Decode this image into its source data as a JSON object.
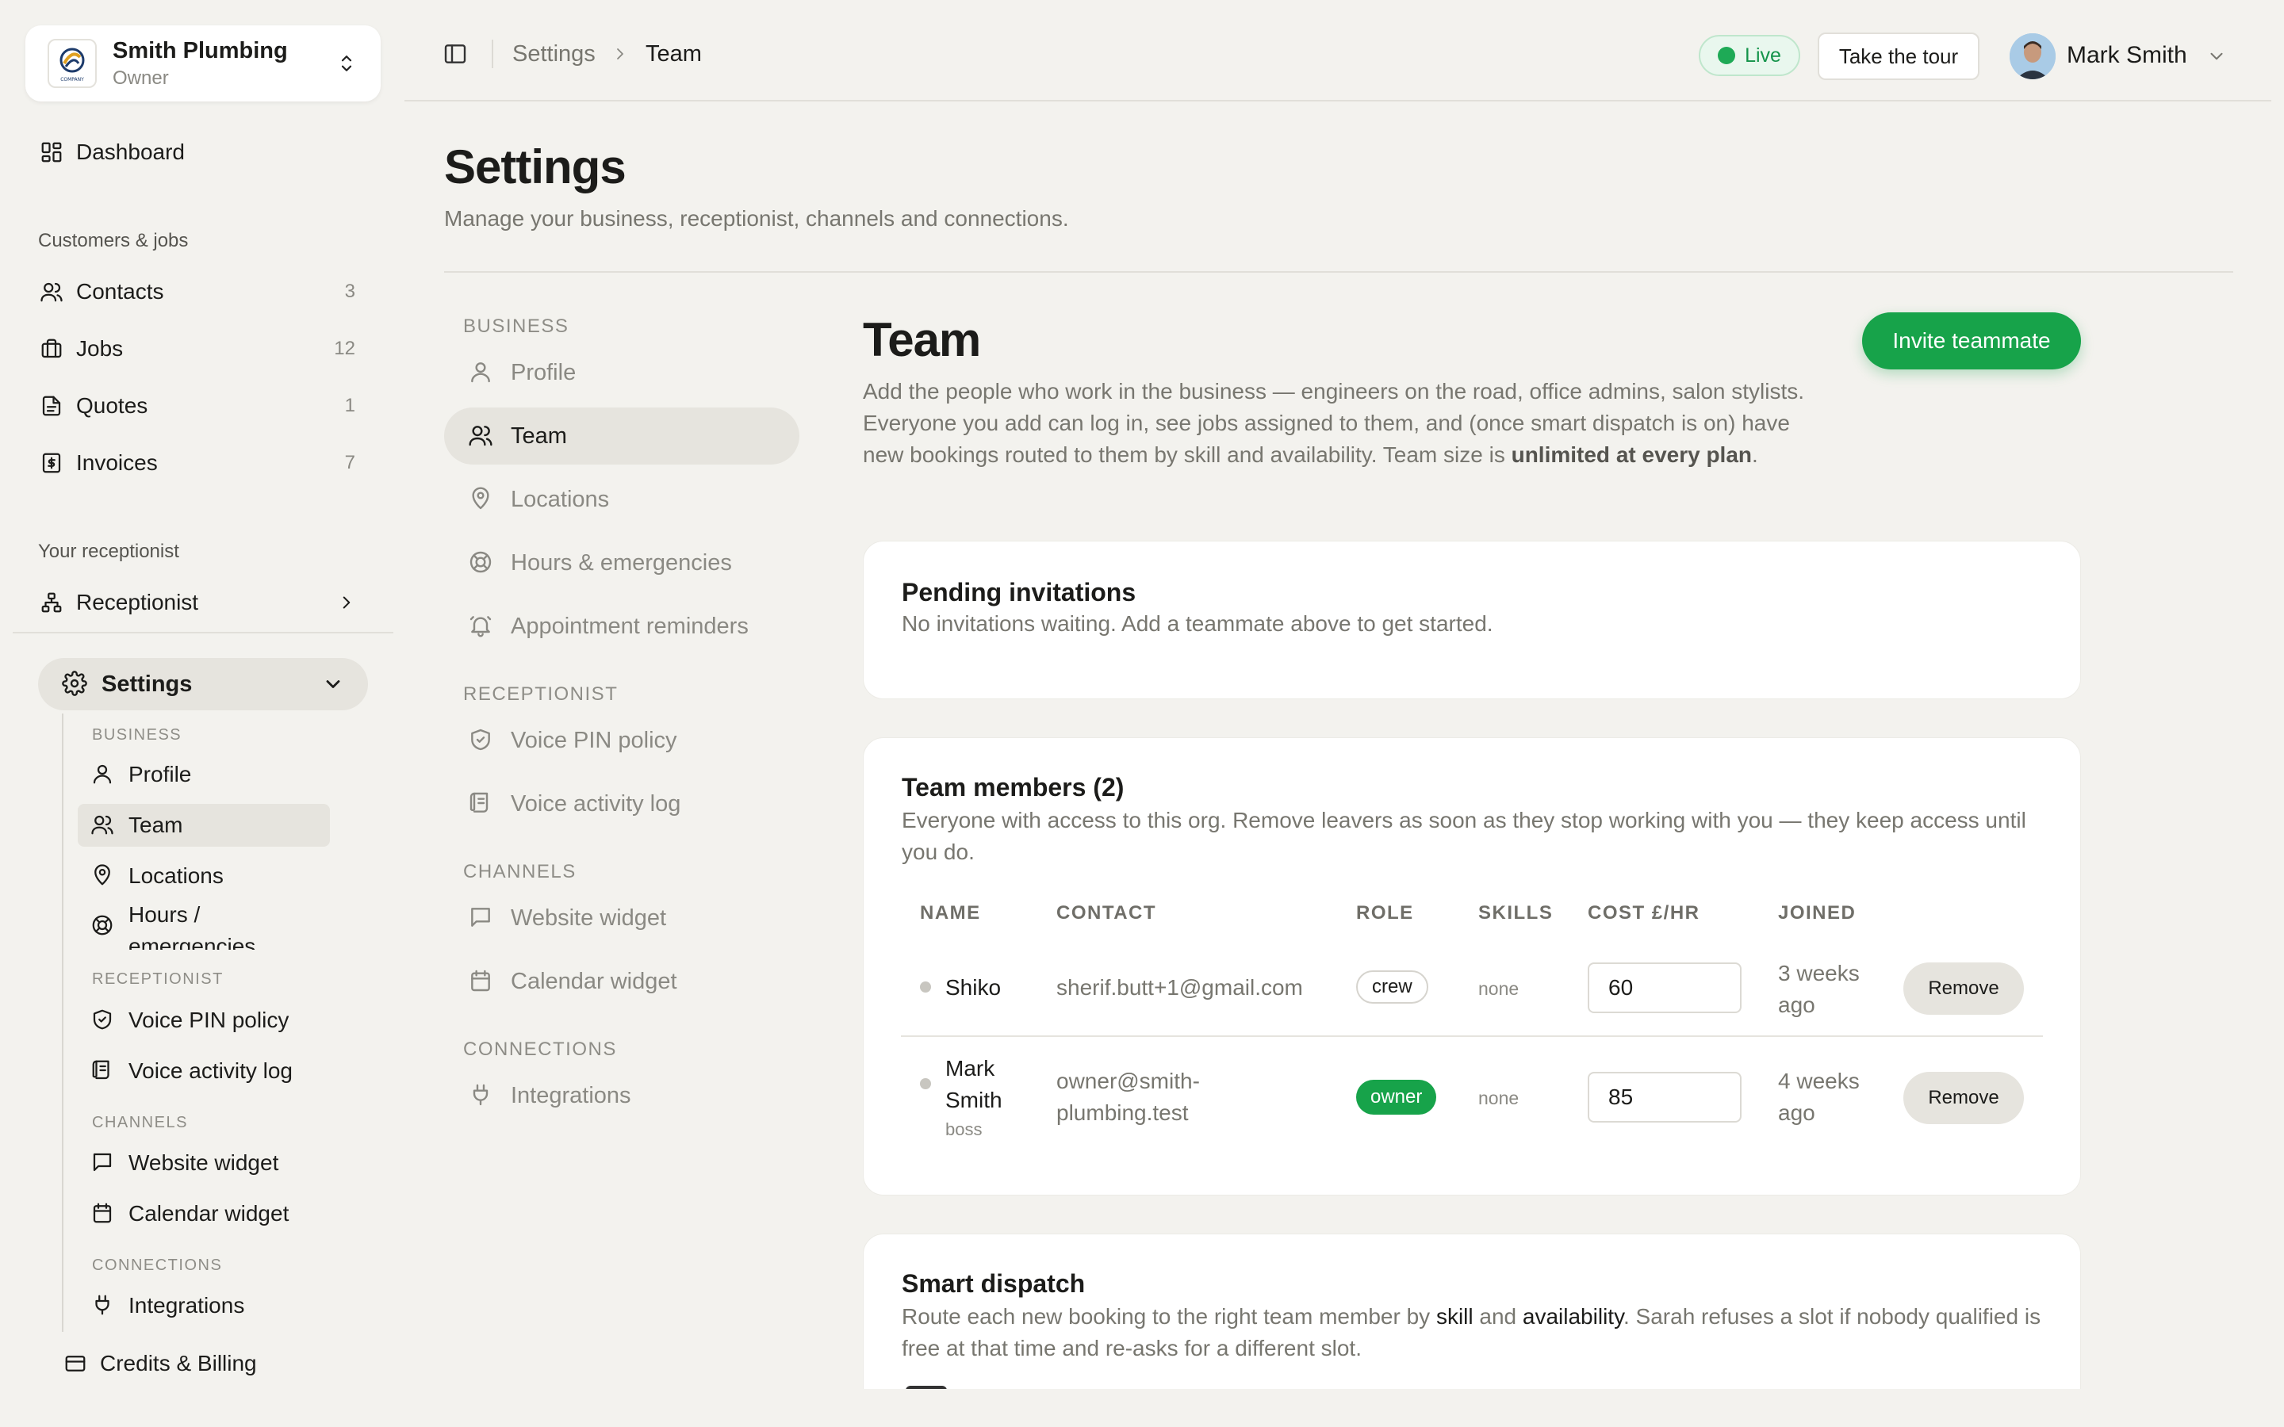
{
  "org": {
    "name": "Smith Plumbing",
    "role": "Owner",
    "logo_text": "COMPANY"
  },
  "sidebar": {
    "dashboard": "Dashboard",
    "section_customers": "Customers & jobs",
    "contacts": {
      "label": "Contacts",
      "count": "3"
    },
    "jobs": {
      "label": "Jobs",
      "count": "12"
    },
    "quotes": {
      "label": "Quotes",
      "count": "1"
    },
    "invoices": {
      "label": "Invoices",
      "count": "7"
    },
    "section_receptionist": "Your receptionist",
    "receptionist": "Receptionist",
    "settings": "Settings",
    "sub": {
      "business_heading": "BUSINESS",
      "profile": "Profile",
      "team": "Team",
      "locations": "Locations",
      "hours_line1": "Hours /",
      "hours_line2": "emergencies",
      "receptionist_heading": "RECEPTIONIST",
      "voice_pin": "Voice PIN policy",
      "voice_log": "Voice activity log",
      "channels_heading": "CHANNELS",
      "website_widget": "Website widget",
      "calendar_widget": "Calendar widget",
      "connections_heading": "CONNECTIONS",
      "integrations": "Integrations"
    },
    "billing": "Credits & Billing"
  },
  "topbar": {
    "crumb_settings": "Settings",
    "crumb_team": "Team",
    "live": "Live",
    "tour": "Take the tour",
    "user_name": "Mark Smith"
  },
  "page": {
    "title": "Settings",
    "subtitle": "Manage your business, receptionist, channels and connections."
  },
  "settings_nav": {
    "business_heading": "BUSINESS",
    "profile": "Profile",
    "team": "Team",
    "locations": "Locations",
    "hours": "Hours & emergencies",
    "reminders": "Appointment reminders",
    "receptionist_heading": "RECEPTIONIST",
    "voice_pin": "Voice PIN policy",
    "voice_log": "Voice activity log",
    "channels_heading": "CHANNELS",
    "website_widget": "Website widget",
    "calendar_widget": "Calendar widget",
    "connections_heading": "CONNECTIONS",
    "integrations": "Integrations"
  },
  "team": {
    "title": "Team",
    "desc_part1": "Add the people who work in the business — engineers on the road, office admins, salon stylists. Everyone you add can log in, see jobs assigned to them, and (once smart dispatch is on) have new bookings routed to them by skill and availability. Team size is ",
    "desc_bold": "unlimited at every plan",
    "desc_end": ".",
    "invite_button": "Invite teammate",
    "pending": {
      "title": "Pending invitations",
      "empty": "No invitations waiting. Add a teammate above to get started."
    },
    "members": {
      "title": "Team members (2)",
      "desc": "Everyone with access to this org. Remove leavers as soon as they stop working with you — they keep access until you do.",
      "columns": {
        "name": "NAME",
        "contact": "CONTACT",
        "role": "ROLE",
        "skills": "SKILLS",
        "cost": "COST £/HR",
        "joined": "JOINED"
      },
      "rows": [
        {
          "name": "Shiko",
          "subtitle": "",
          "contact_line1": "sherif.butt+1@gmail.com",
          "contact_line2": "",
          "role": "crew",
          "skills": "none",
          "cost": "60",
          "joined_line1": "3 weeks",
          "joined_line2": "ago",
          "action": "Remove"
        },
        {
          "name_line1": "Mark",
          "name_line2": "Smith",
          "subtitle": "boss",
          "contact_line1": "owner@smith-",
          "contact_line2": "plumbing.test",
          "role": "owner",
          "skills": "none",
          "cost": "85",
          "joined_line1": "4 weeks",
          "joined_line2": "ago",
          "action": "Remove"
        }
      ]
    },
    "dispatch": {
      "title": "Smart dispatch",
      "text_1": "Route each new booking to the right team member by ",
      "bold_1": "skill",
      "text_2": " and ",
      "bold_2": "availability",
      "text_3": ". Sarah refuses a slot if nobody qualified is free at that time and re-asks for a different slot."
    }
  },
  "colors": {
    "accent_green": "#17a34a",
    "background": "#f3f2ee",
    "live_green": "#1eaa56"
  }
}
